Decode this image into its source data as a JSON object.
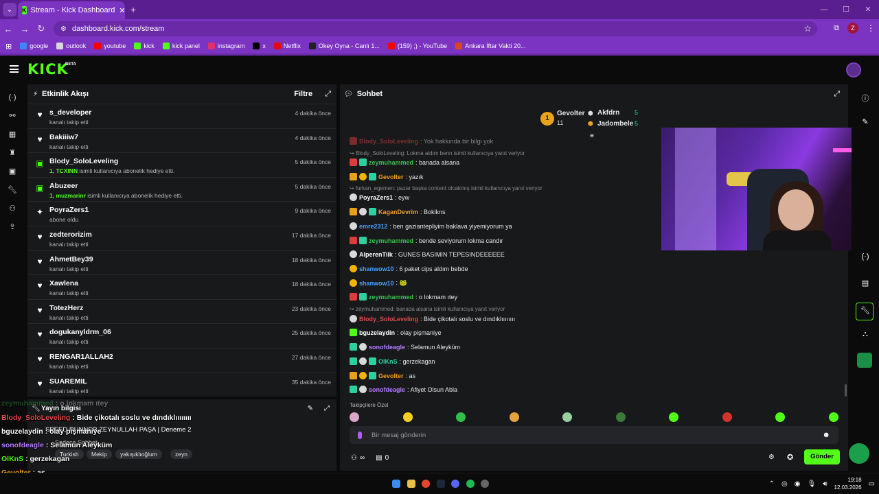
{
  "browser": {
    "tab_title": "Stream - Kick Dashboard",
    "url": "dashboard.kick.com/stream",
    "bookmarks": [
      {
        "label": "google",
        "color": "#4285f4"
      },
      {
        "label": "outlook",
        "color": "#d8d8d8"
      },
      {
        "label": "youtube",
        "color": "#ff0000"
      },
      {
        "label": "kick",
        "color": "#53fc18"
      },
      {
        "label": "kick panel",
        "color": "#53fc18"
      },
      {
        "label": "instagram",
        "color": "#e1306c"
      },
      {
        "label": "x",
        "color": "#000000"
      },
      {
        "label": "Netflix",
        "color": "#e50914"
      },
      {
        "label": "Okey Oyna - Canlı 1...",
        "color": "#222222"
      },
      {
        "label": "(159) ;) - YouTube",
        "color": "#ff0000"
      },
      {
        "label": "Ankara İftar Vakti 20...",
        "color": "#d64a1a"
      }
    ],
    "profile_initial": "Z"
  },
  "kick": {
    "logo": "KICK",
    "beta": "BETA"
  },
  "activity": {
    "title": "Etkinlik Akışı",
    "filter_label": "Filtre",
    "items": [
      {
        "icon": "heart-icon",
        "name": "s_developer",
        "desc": "kanalı takip etti",
        "time": "4 dakika önce"
      },
      {
        "icon": "heart-icon",
        "name": "Bakiiiw7",
        "desc": "kanalı takip etti",
        "time": "4 dakika önce"
      },
      {
        "icon": "gift-icon",
        "name": "Blody_SoloLeveling",
        "desc_bold": "1, TCXINN",
        "desc": " isimli kullanıcıya abonelik hediye etti.",
        "time": "5 dakika önce"
      },
      {
        "icon": "gift-icon",
        "name": "Abuzeer",
        "desc_bold": "1, muzmarinr",
        "desc": " isimli kullanıcıya abonelik hediye etti.",
        "time": "5 dakika önce"
      },
      {
        "icon": "star-icon",
        "name": "PoyraZers1",
        "desc": "abone oldu",
        "time": "9 dakika önce"
      },
      {
        "icon": "heart-icon",
        "name": "zedterorizim",
        "desc": "kanalı takip etti",
        "time": "17 dakika önce"
      },
      {
        "icon": "heart-icon",
        "name": "AhmetBey39",
        "desc": "kanalı takip etti",
        "time": "18 dakika önce"
      },
      {
        "icon": "heart-icon",
        "name": "Xawlena",
        "desc": "kanalı takip etti",
        "time": "18 dakika önce"
      },
      {
        "icon": "heart-icon",
        "name": "TotezHerz",
        "desc": "kanalı takip etti",
        "time": "23 dakika önce"
      },
      {
        "icon": "heart-icon",
        "name": "dogukanyldrm_06",
        "desc": "kanalı takip etti",
        "time": "25 dakika önce"
      },
      {
        "icon": "heart-icon",
        "name": "RENGAR1ALLAH2",
        "desc": "kanalı takip etti",
        "time": "27 dakika önce"
      },
      {
        "icon": "heart-icon",
        "name": "SUAREMIL",
        "desc": "kanalı takip etti",
        "time": "35 dakika önce"
      }
    ]
  },
  "stream_info": {
    "title": "Yayın bilgisi",
    "stream_title": "SPEED RUNNER ZEYNULLAH PAŞA | Deneme 2",
    "category": "Sadece Sohbet",
    "tags": [
      "Turkish",
      "Mekip",
      "yakışıklıoğlum",
      "zeyn"
    ]
  },
  "overlay_chat": [
    {
      "name": "zeymuhammed",
      "msg": ": o lokmam ıtey",
      "color": "#39c24a"
    },
    {
      "name": "Blody_SoloLeveling",
      "msg": ": Bide çikotalı soslu ve dındıklıııııııı",
      "color": "#e04a4a"
    },
    {
      "name": "bguzelaydin",
      "msg": ": olay pişmaniye",
      "color": "#fff"
    },
    {
      "name": "sonofdeagle",
      "msg": ": Selamun Aleyküm",
      "color": "#b67cff"
    },
    {
      "name": "OlKnS",
      "msg": ": gerzekagan",
      "color": "#53fc18"
    },
    {
      "name": "Gevolter",
      "msg": ": as",
      "color": "#f0a020"
    },
    {
      "name": "sonofdeagle",
      "msg": ": Afiyet Olsun Abla",
      "color": "#b67cff"
    }
  ],
  "chat": {
    "title": "Sohbet",
    "leaderboard": [
      {
        "rank": "1",
        "name": "Gevolter",
        "count": "11",
        "color": "#f0a020"
      },
      {
        "rank": "",
        "name": "Akfdrn",
        "count": "5",
        "color": "#ffffff"
      },
      {
        "rank": "",
        "name": "Jadombele",
        "count": "5",
        "color": "#f0a020"
      }
    ],
    "messages": [
      {
        "type": "msg",
        "name": "Blody_SoloLeveling",
        "text": ": Yok hakkında bir bilgi yok",
        "color": "#e04a4a",
        "badges": [
          "red"
        ]
      },
      {
        "type": "reply",
        "text": "Blody_SoloLeveling: Lokma aldım benn isimli kullanıcıya yanıt veriyor"
      },
      {
        "type": "msg",
        "name": "zeymuhammed",
        "text": ": banada alsana",
        "color": "#39c24a",
        "badges": [
          "red",
          "gift"
        ]
      },
      {
        "type": "msg",
        "name": "Gevolter",
        "text": ": yazık",
        "color": "#f0a020",
        "badges": [
          "sub",
          "crown",
          "gift"
        ]
      },
      {
        "type": "reply",
        "text": "furkan_egemen: pazar başka content olcakmış isimli kullanıcıya yanıt veriyor"
      },
      {
        "type": "msg",
        "name": "PoyraZers1",
        "text": ": eyw",
        "color": "#ffffff",
        "badges": [
          "cat"
        ]
      },
      {
        "type": "msg",
        "name": "KaganDevrim",
        "text": ": Boklkns",
        "color": "#f0a020",
        "badges": [
          "sub",
          "cat",
          "gift"
        ]
      },
      {
        "type": "msg",
        "name": "emre2312",
        "text": ": ben gaziantepliyim baklava yiyemiyorum ya",
        "color": "#4aa0ff",
        "badges": [
          "cat"
        ]
      },
      {
        "type": "msg",
        "name": "zeymuhammed",
        "text": ": bende seviyorum lokma candır",
        "color": "#39c24a",
        "badges": [
          "red",
          "gift"
        ]
      },
      {
        "type": "msg",
        "name": "AlperenTilk",
        "text": ": GUNES BASIMIN TEPESINDEEEEEE",
        "color": "#ffffff",
        "badges": [
          "cat"
        ]
      },
      {
        "type": "msg",
        "name": "shanwow10",
        "text": ": 6 paket cips aldım bebde",
        "color": "#4aa0ff",
        "badges": [
          "crown"
        ]
      },
      {
        "type": "msg",
        "name": "shanwow10",
        "text": ": 🐸",
        "color": "#4aa0ff",
        "badges": [
          "crown"
        ]
      },
      {
        "type": "msg",
        "name": "zeymuhammed",
        "text": ": o lokmam ıtey",
        "color": "#39c24a",
        "badges": [
          "red",
          "gift"
        ]
      },
      {
        "type": "reply",
        "text": "zeymuhammed: banada alsana isimli kullanıcıya yanıt veriyor"
      },
      {
        "type": "msg",
        "name": "Blody_SoloLeveling",
        "text": ": Bide çikotalı soslu ve dındıklıııııııı",
        "color": "#e04a4a",
        "badges": [
          "cat"
        ]
      },
      {
        "type": "msg",
        "name": "bguzelaydin",
        "text": ": olay pişmaniye",
        "color": "#ffffff",
        "badges": [
          "mod"
        ]
      },
      {
        "type": "msg",
        "name": "sonofdeagle",
        "text": ": Selamun Aleyküm",
        "color": "#b67cff",
        "badges": [
          "gift",
          "cat"
        ]
      },
      {
        "type": "msg",
        "name": "OlKnS",
        "text": ": gerzekagan",
        "color": "#2fd0a0",
        "badges": [
          "gift",
          "cat",
          "gift"
        ]
      },
      {
        "type": "msg",
        "name": "Gevolter",
        "text": ": as",
        "color": "#f0a020",
        "badges": [
          "sub",
          "crown",
          "gift"
        ]
      },
      {
        "type": "msg",
        "name": "sonofdeagle",
        "text": ": Afiyet Olsun Abla",
        "color": "#b67cff",
        "badges": [
          "gift",
          "cat"
        ]
      }
    ],
    "followers_label": "Takipçilere Özel",
    "input_placeholder": "Bir mesaj gönderin",
    "viewers_value": "∞",
    "emote_count": "0",
    "send_label": "Gönder"
  },
  "taskbar": {
    "time": "19:18",
    "date": "12.03.2026"
  }
}
